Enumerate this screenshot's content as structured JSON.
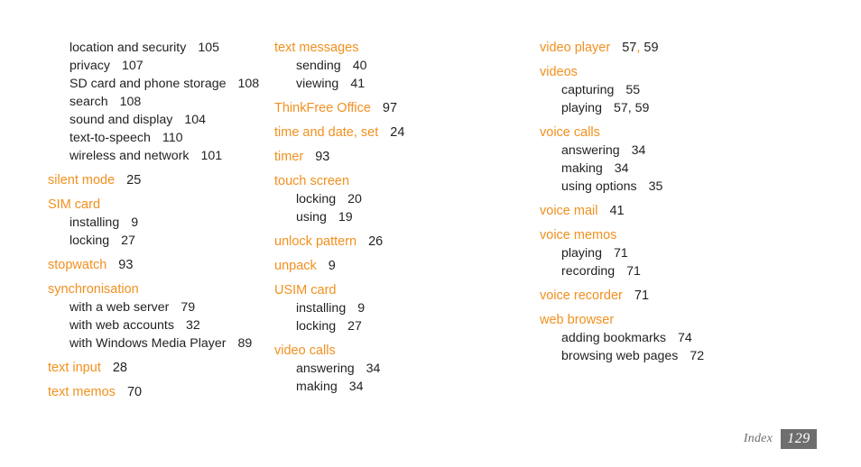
{
  "page": {
    "background": "#ffffff",
    "heading_color": "#F1901E",
    "text_color": "#231F20",
    "footer_box_color": "#6E6E6E"
  },
  "footer": {
    "label": "Index",
    "page_number": "129"
  },
  "columns": [
    {
      "entries": [
        {
          "term": "",
          "pages": "",
          "hide_head": true,
          "subs": [
            {
              "label": "location and security",
              "pages": "105"
            },
            {
              "label": "privacy",
              "pages": "107"
            },
            {
              "label": "SD card and phone storage",
              "pages": "108"
            },
            {
              "label": "search",
              "pages": "108"
            },
            {
              "label": "sound and display",
              "pages": "104"
            },
            {
              "label": "text-to-speech",
              "pages": "110"
            },
            {
              "label": "wireless and network",
              "pages": "101"
            }
          ]
        },
        {
          "term": "silent mode",
          "pages": "25",
          "subs": []
        },
        {
          "term": "SIM card",
          "pages": "",
          "subs": [
            {
              "label": "installing",
              "pages": "9"
            },
            {
              "label": "locking",
              "pages": "27"
            }
          ]
        },
        {
          "term": "stopwatch",
          "pages": "93",
          "subs": []
        },
        {
          "term": "synchronisation",
          "pages": "",
          "subs": [
            {
              "label": "with a web server",
              "pages": "79"
            },
            {
              "label": "with web accounts",
              "pages": "32"
            },
            {
              "label": "with Windows Media Player",
              "pages": "89"
            }
          ]
        },
        {
          "term": "text input",
          "pages": "28",
          "subs": []
        },
        {
          "term": "text memos",
          "pages": "70",
          "subs": []
        }
      ]
    },
    {
      "entries": [
        {
          "term": "text messages",
          "pages": "",
          "subs": [
            {
              "label": "sending",
              "pages": "40"
            },
            {
              "label": "viewing",
              "pages": "41"
            }
          ]
        },
        {
          "term": "ThinkFree Office",
          "pages": "97",
          "subs": []
        },
        {
          "term": "time and date, set",
          "pages": "24",
          "subs": []
        },
        {
          "term": "timer",
          "pages": "93",
          "subs": []
        },
        {
          "term": "touch screen",
          "pages": "",
          "subs": [
            {
              "label": "locking",
              "pages": "20"
            },
            {
              "label": "using",
              "pages": "19"
            }
          ]
        },
        {
          "term": "unlock pattern",
          "pages": "26",
          "subs": []
        },
        {
          "term": "unpack",
          "pages": "9",
          "subs": []
        },
        {
          "term": "USIM card",
          "pages": "",
          "subs": [
            {
              "label": "installing",
              "pages": "9"
            },
            {
              "label": "locking",
              "pages": "27"
            }
          ]
        },
        {
          "term": "video calls",
          "pages": "",
          "subs": [
            {
              "label": "answering",
              "pages": "34"
            },
            {
              "label": "making",
              "pages": "34"
            }
          ]
        }
      ]
    },
    {
      "entries": [
        {
          "term": "video player",
          "pages": "57, 59",
          "pages_orange_sep": true,
          "subs": []
        },
        {
          "term": "videos",
          "pages": "",
          "subs": [
            {
              "label": "capturing",
              "pages": "55"
            },
            {
              "label": "playing",
              "pages": "57, 59"
            }
          ]
        },
        {
          "term": "voice calls",
          "pages": "",
          "subs": [
            {
              "label": "answering",
              "pages": "34"
            },
            {
              "label": "making",
              "pages": "34"
            },
            {
              "label": "using options",
              "pages": "35"
            }
          ]
        },
        {
          "term": "voice mail",
          "pages": "41",
          "subs": []
        },
        {
          "term": "voice memos",
          "pages": "",
          "subs": [
            {
              "label": "playing",
              "pages": "71"
            },
            {
              "label": "recording",
              "pages": "71"
            }
          ]
        },
        {
          "term": "voice recorder",
          "pages": "71",
          "subs": []
        },
        {
          "term": "web browser",
          "pages": "",
          "subs": [
            {
              "label": "adding bookmarks",
              "pages": "74"
            },
            {
              "label": "browsing web pages",
              "pages": "72"
            }
          ]
        }
      ]
    }
  ]
}
